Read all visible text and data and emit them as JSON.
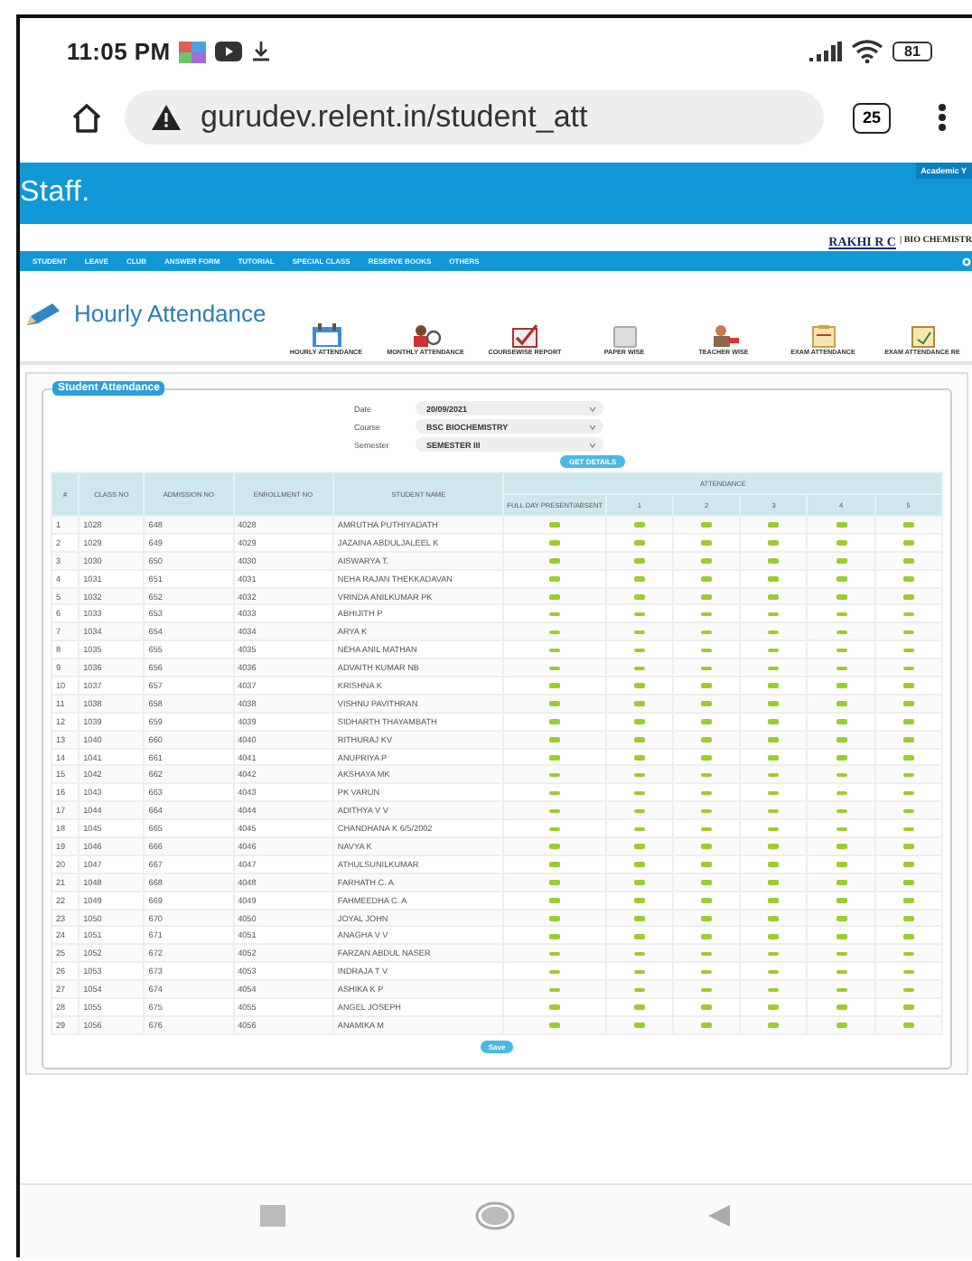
{
  "status_bar": {
    "time": "11:05 PM",
    "battery": "81"
  },
  "browser": {
    "url": "gurudev.relent.in/student_att",
    "tab_count": "25"
  },
  "header": {
    "logo": "Staff.",
    "academic_year": "Academic Y",
    "user_name": "RAKHI R C",
    "department": "| BIO CHEMISTR"
  },
  "nav_menu": [
    "STUDENT",
    "LEAVE",
    "CLUB",
    "ANSWER FORM",
    "TUTORIAL",
    "SPECIAL CLASS",
    "RESERVE BOOKS",
    "OTHERS"
  ],
  "page_title": "Hourly Attendance",
  "toolbar": [
    "HOURLY ATTENDANCE",
    "MONTHLY ATTENDANCE",
    "COURSEWISE REPORT",
    "PAPER WISE",
    "TEACHER WISE",
    "EXAM ATTENDANCE",
    "EXAM ATTENDANCE RE"
  ],
  "panel": {
    "title": "Student Attendance",
    "fields": [
      {
        "label": "Date",
        "value": "20/09/2021"
      },
      {
        "label": "Course",
        "value": "BSC BIOCHEMISTRY"
      },
      {
        "label": "Semester",
        "value": "SEMESTER III"
      }
    ],
    "get_button": "GET DETAILS",
    "table": {
      "columns": [
        "#",
        "CLASS NO",
        "ADMISSION NO",
        "ENROLLMENT NO",
        "STUDENT NAME"
      ],
      "group_header": "ATTENDANCE",
      "attendance_columns": [
        "FULL DAY PRESENT/ABSENT",
        "1",
        "2",
        "3",
        "4",
        "5"
      ],
      "rows": [
        {
          "cells": [
            "1",
            "1028",
            "648",
            "4028",
            "AMRUTHA PUTHIYADATH"
          ],
          "present": [
            true,
            true,
            true,
            true,
            true,
            true
          ]
        },
        {
          "cells": [
            "2",
            "1029",
            "649",
            "4029",
            "JAZAINA ABDULJALEEL K"
          ],
          "present": [
            true,
            true,
            true,
            true,
            true,
            true
          ]
        },
        {
          "cells": [
            "3",
            "1030",
            "650",
            "4030",
            "AISWARYA T."
          ],
          "present": [
            true,
            true,
            true,
            true,
            true,
            true
          ]
        },
        {
          "cells": [
            "4",
            "1031",
            "651",
            "4031",
            "NEHA RAJAN THEKKADAVAN"
          ],
          "present": [
            true,
            true,
            true,
            true,
            true,
            true
          ]
        },
        {
          "cells": [
            "5",
            "1032",
            "652",
            "4032",
            "VRINDA ANILKUMAR PK"
          ],
          "present": [
            true,
            true,
            true,
            true,
            true,
            true
          ]
        },
        {
          "cells": [
            "6",
            "1033",
            "653",
            "4033",
            "ABHIJITH P"
          ],
          "present": [
            true,
            true,
            true,
            true,
            true,
            true
          ]
        },
        {
          "cells": [
            "7",
            "1034",
            "654",
            "4034",
            "ARYA K"
          ],
          "present": [
            true,
            true,
            true,
            true,
            true,
            true
          ]
        },
        {
          "cells": [
            "8",
            "1035",
            "655",
            "4035",
            "NEHA ANIL MATHAN"
          ],
          "present": [
            true,
            true,
            true,
            true,
            true,
            true
          ]
        },
        {
          "cells": [
            "9",
            "1036",
            "656",
            "4036",
            "ADVAITH KUMAR NB"
          ],
          "present": [
            true,
            true,
            true,
            true,
            true,
            true
          ]
        },
        {
          "cells": [
            "10",
            "1037",
            "657",
            "4037",
            "KRISHNA K"
          ],
          "present": [
            true,
            true,
            true,
            true,
            true,
            true
          ]
        },
        {
          "cells": [
            "11",
            "1038",
            "658",
            "4038",
            "VISHNU PAVITHRAN"
          ],
          "present": [
            true,
            true,
            true,
            true,
            true,
            true
          ]
        },
        {
          "cells": [
            "12",
            "1039",
            "659",
            "4039",
            "SIDHARTH THAYAMBATH"
          ],
          "present": [
            true,
            true,
            true,
            true,
            true,
            true
          ]
        },
        {
          "cells": [
            "13",
            "1040",
            "660",
            "4040",
            "RITHURAJ KV"
          ],
          "present": [
            true,
            true,
            true,
            true,
            true,
            true
          ]
        },
        {
          "cells": [
            "14",
            "1041",
            "661",
            "4041",
            "ANUPRIYA P"
          ],
          "present": [
            true,
            true,
            true,
            true,
            true,
            true
          ]
        },
        {
          "cells": [
            "15",
            "1042",
            "662",
            "4042",
            "AKSHAYA MK"
          ],
          "present": [
            true,
            true,
            true,
            true,
            true,
            true
          ]
        },
        {
          "cells": [
            "16",
            "1043",
            "663",
            "4043",
            "PK VARUN"
          ],
          "present": [
            true,
            true,
            true,
            true,
            true,
            true
          ]
        },
        {
          "cells": [
            "17",
            "1044",
            "664",
            "4044",
            "ADITHYA V V"
          ],
          "present": [
            true,
            true,
            true,
            true,
            true,
            true
          ]
        },
        {
          "cells": [
            "18",
            "1045",
            "665",
            "4045",
            "CHANDHANA K 6/5/2002"
          ],
          "present": [
            true,
            true,
            true,
            true,
            true,
            true
          ]
        },
        {
          "cells": [
            "19",
            "1046",
            "666",
            "4046",
            "NAVYA K"
          ],
          "present": [
            true,
            true,
            true,
            true,
            true,
            true
          ]
        },
        {
          "cells": [
            "20",
            "1047",
            "667",
            "4047",
            "ATHULSUNILKUMAR"
          ],
          "present": [
            true,
            true,
            true,
            true,
            true,
            true
          ]
        },
        {
          "cells": [
            "21",
            "1048",
            "668",
            "4048",
            "FARHATH C. A"
          ],
          "present": [
            true,
            true,
            true,
            true,
            true,
            true
          ]
        },
        {
          "cells": [
            "22",
            "1049",
            "669",
            "4049",
            "FAHMEEDHA C. A"
          ],
          "present": [
            true,
            true,
            true,
            true,
            true,
            true
          ]
        },
        {
          "cells": [
            "23",
            "1050",
            "670",
            "4050",
            "JOYAL JOHN"
          ],
          "present": [
            true,
            true,
            true,
            true,
            true,
            true
          ]
        },
        {
          "cells": [
            "24",
            "1051",
            "671",
            "4051",
            "ANAGHA V V"
          ],
          "present": [
            true,
            true,
            true,
            true,
            true,
            true
          ]
        },
        {
          "cells": [
            "25",
            "1052",
            "672",
            "4052",
            "FARZAN ABDUL NASER"
          ],
          "present": [
            true,
            true,
            true,
            true,
            true,
            true
          ]
        },
        {
          "cells": [
            "26",
            "1053",
            "673",
            "4053",
            "INDRAJA T V"
          ],
          "present": [
            true,
            true,
            true,
            true,
            true,
            true
          ]
        },
        {
          "cells": [
            "27",
            "1054",
            "674",
            "4054",
            "ASHIKA K P"
          ],
          "present": [
            true,
            true,
            true,
            true,
            true,
            true
          ]
        },
        {
          "cells": [
            "28",
            "1055",
            "675",
            "4055",
            "ANGEL JOSEPH"
          ],
          "present": [
            true,
            true,
            true,
            true,
            true,
            true
          ]
        },
        {
          "cells": [
            "29",
            "1056",
            "676",
            "4056",
            "ANAMIKA M"
          ],
          "present": [
            true,
            true,
            true,
            true,
            true,
            true
          ]
        }
      ]
    },
    "save_button": "Save"
  }
}
